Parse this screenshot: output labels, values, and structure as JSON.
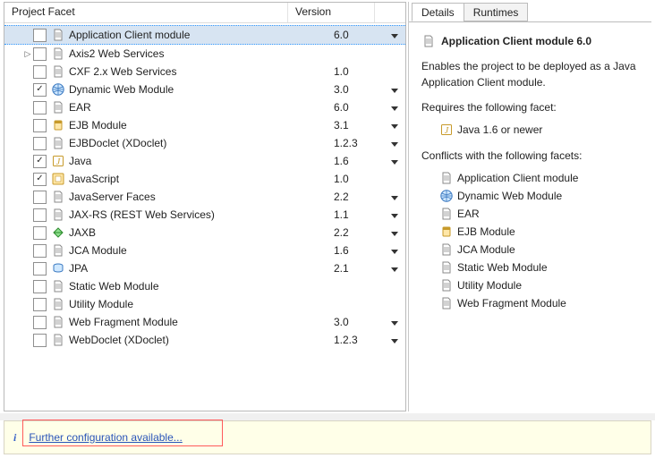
{
  "left": {
    "columns": {
      "facet": "Project Facet",
      "version": "Version"
    },
    "rows": [
      {
        "name": "Application Client module",
        "checked": false,
        "expandable": false,
        "version": "6.0",
        "hasDropdown": true,
        "icon": "doc",
        "selected": true
      },
      {
        "name": "Axis2 Web Services",
        "checked": false,
        "expandable": true,
        "version": "",
        "hasDropdown": false,
        "icon": "doc"
      },
      {
        "name": "CXF 2.x Web Services",
        "checked": false,
        "expandable": false,
        "version": "1.0",
        "hasDropdown": false,
        "icon": "doc"
      },
      {
        "name": "Dynamic Web Module",
        "checked": true,
        "expandable": false,
        "version": "3.0",
        "hasDropdown": true,
        "icon": "globe"
      },
      {
        "name": "EAR",
        "checked": false,
        "expandable": false,
        "version": "6.0",
        "hasDropdown": true,
        "icon": "doc"
      },
      {
        "name": "EJB Module",
        "checked": false,
        "expandable": false,
        "version": "3.1",
        "hasDropdown": true,
        "icon": "jar"
      },
      {
        "name": "EJBDoclet (XDoclet)",
        "checked": false,
        "expandable": false,
        "version": "1.2.3",
        "hasDropdown": true,
        "icon": "doc"
      },
      {
        "name": "Java",
        "checked": true,
        "expandable": false,
        "version": "1.6",
        "hasDropdown": true,
        "icon": "java"
      },
      {
        "name": "JavaScript",
        "checked": true,
        "expandable": false,
        "version": "1.0",
        "hasDropdown": false,
        "icon": "js"
      },
      {
        "name": "JavaServer Faces",
        "checked": false,
        "expandable": false,
        "version": "2.2",
        "hasDropdown": true,
        "icon": "doc"
      },
      {
        "name": "JAX-RS (REST Web Services)",
        "checked": false,
        "expandable": false,
        "version": "1.1",
        "hasDropdown": true,
        "icon": "doc"
      },
      {
        "name": "JAXB",
        "checked": false,
        "expandable": false,
        "version": "2.2",
        "hasDropdown": true,
        "icon": "jaxb"
      },
      {
        "name": "JCA Module",
        "checked": false,
        "expandable": false,
        "version": "1.6",
        "hasDropdown": true,
        "icon": "doc"
      },
      {
        "name": "JPA",
        "checked": false,
        "expandable": false,
        "version": "2.1",
        "hasDropdown": true,
        "icon": "jpa"
      },
      {
        "name": "Static Web Module",
        "checked": false,
        "expandable": false,
        "version": "",
        "hasDropdown": false,
        "icon": "doc"
      },
      {
        "name": "Utility Module",
        "checked": false,
        "expandable": false,
        "version": "",
        "hasDropdown": false,
        "icon": "doc"
      },
      {
        "name": "Web Fragment Module",
        "checked": false,
        "expandable": false,
        "version": "3.0",
        "hasDropdown": true,
        "icon": "doc"
      },
      {
        "name": "WebDoclet (XDoclet)",
        "checked": false,
        "expandable": false,
        "version": "1.2.3",
        "hasDropdown": true,
        "icon": "doc"
      }
    ]
  },
  "right": {
    "tabs": {
      "details": "Details",
      "runtimes": "Runtimes"
    },
    "activeTab": "details",
    "title": "Application Client module 6.0",
    "description": "Enables the project to be deployed as a Java Application Client module.",
    "requiresLabel": "Requires the following facet:",
    "requires": [
      {
        "name": "Java 1.6 or newer",
        "icon": "java"
      }
    ],
    "conflictsLabel": "Conflicts with the following facets:",
    "conflicts": [
      {
        "name": "Application Client module",
        "icon": "doc"
      },
      {
        "name": "Dynamic Web Module",
        "icon": "globe"
      },
      {
        "name": "EAR",
        "icon": "doc"
      },
      {
        "name": "EJB Module",
        "icon": "jar"
      },
      {
        "name": "JCA Module",
        "icon": "doc"
      },
      {
        "name": "Static Web Module",
        "icon": "doc"
      },
      {
        "name": "Utility Module",
        "icon": "doc"
      },
      {
        "name": "Web Fragment Module",
        "icon": "doc"
      }
    ]
  },
  "footer": {
    "link": "Further configuration available..."
  },
  "icons": {
    "doc": "doc",
    "globe": "globe",
    "jar": "jar",
    "java": "java",
    "js": "js",
    "jaxb": "jaxb",
    "jpa": "jpa"
  }
}
